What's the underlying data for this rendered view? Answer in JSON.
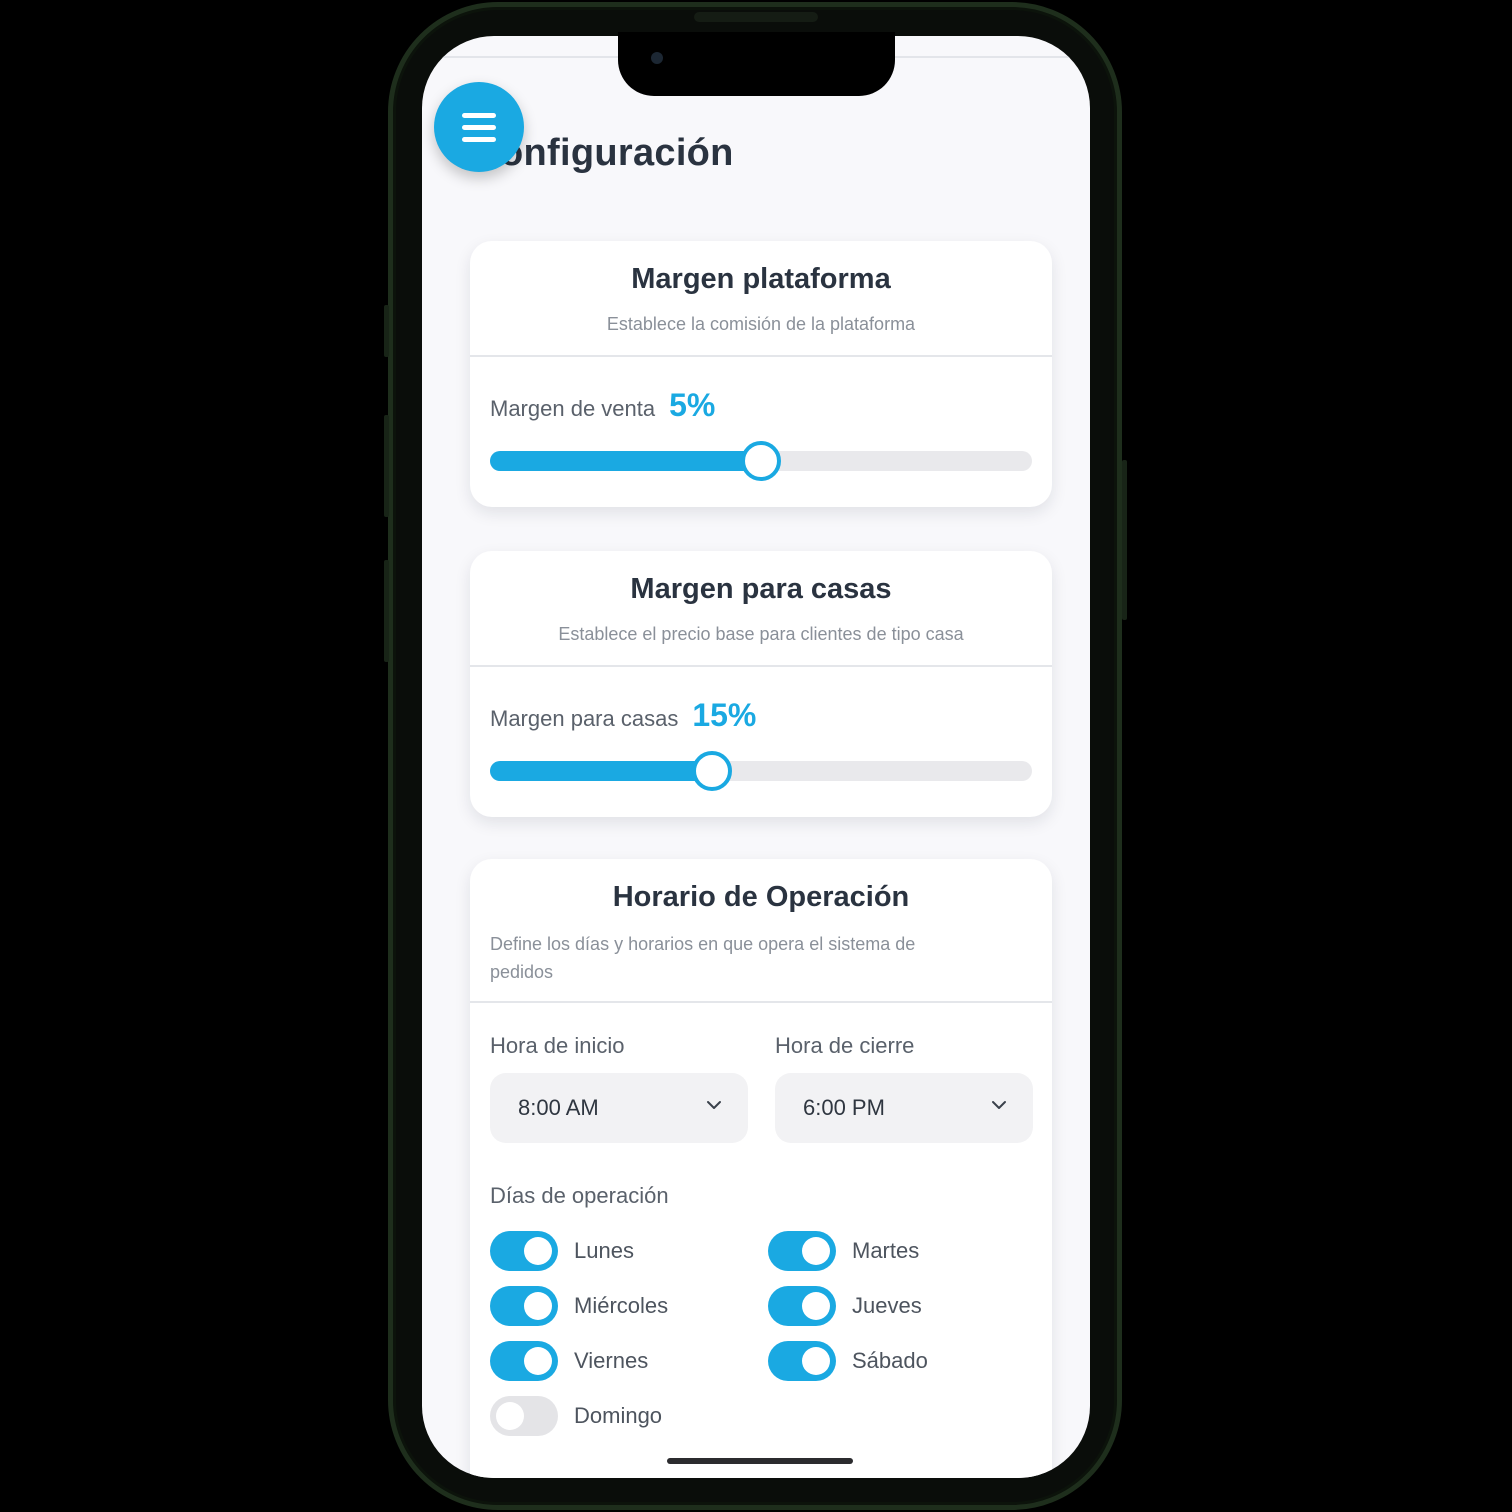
{
  "page": {
    "title": "onfiguración"
  },
  "platform_margin": {
    "title": "Margen plataforma",
    "subtitle": "Establece la comisión de la plataforma",
    "slider_label": "Margen de venta",
    "value_text": "5%",
    "slider_fraction": 0.5
  },
  "house_margin": {
    "title": "Margen para casas",
    "subtitle": "Establece el precio base para clientes de tipo casa",
    "slider_label": "Margen para casas",
    "value_text": "15%",
    "slider_fraction": 0.41
  },
  "schedule": {
    "title": "Horario de Operación",
    "subtitle": "Define los días y horarios en que opera el sistema de pedidos",
    "start_label": "Hora de inicio",
    "start_value": "8:00 AM",
    "end_label": "Hora de cierre",
    "end_value": "6:00 PM",
    "days_label": "Días de operación",
    "days": [
      {
        "label": "Lunes",
        "enabled": true
      },
      {
        "label": "Martes",
        "enabled": true
      },
      {
        "label": "Miércoles",
        "enabled": true
      },
      {
        "label": "Jueves",
        "enabled": true
      },
      {
        "label": "Viernes",
        "enabled": true
      },
      {
        "label": "Sábado",
        "enabled": true
      },
      {
        "label": "Domingo",
        "enabled": false
      }
    ]
  },
  "colors": {
    "accent": "#1aa9e2",
    "background": "#f8f8fb",
    "card": "#ffffff",
    "track": "#e9e9ec"
  }
}
